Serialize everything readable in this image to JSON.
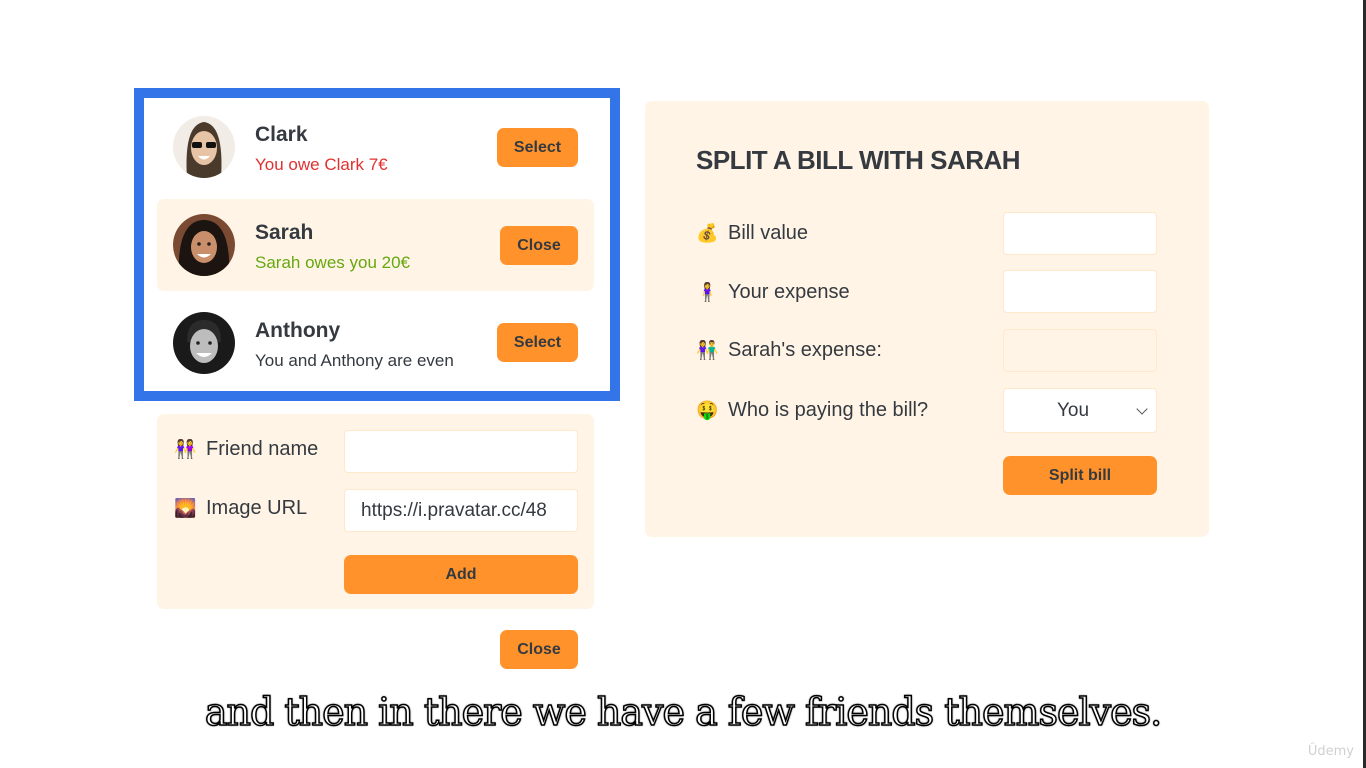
{
  "friends": [
    {
      "name": "Clark",
      "status": "You owe Clark 7€",
      "status_tone": "negative",
      "button": "Select",
      "selected": false
    },
    {
      "name": "Sarah",
      "status": "Sarah owes you 20€",
      "status_tone": "positive",
      "button": "Close",
      "selected": true
    },
    {
      "name": "Anthony",
      "status": "You and Anthony are even",
      "status_tone": "neutral",
      "button": "Select",
      "selected": false
    }
  ],
  "add_friend_form": {
    "friend_name_label": "Friend name",
    "friend_name_icon": "👭",
    "friend_name_value": "",
    "image_url_label": "Image URL",
    "image_url_icon": "🌄",
    "image_url_value": "https://i.pravatar.cc/48",
    "add_button": "Add"
  },
  "close_add_form_button": "Close",
  "split_form": {
    "title": "SPLIT A BILL WITH SARAH",
    "bill_value_icon": "💰",
    "bill_value_label": "Bill value",
    "bill_value": "",
    "your_expense_icon": "🧍‍♀️",
    "your_expense_label": "Your expense",
    "your_expense": "",
    "friend_expense_icon": "👫",
    "friend_expense_label": "Sarah's expense:",
    "friend_expense": "",
    "payer_icon": "🤑",
    "payer_label": "Who is paying the bill?",
    "payer_selected": "You",
    "split_button": "Split bill"
  },
  "subtitle": "and then in there we have a few friends themselves.",
  "watermark": "Ûdemy",
  "colors": {
    "accent": "#ff922b",
    "panel_bg": "#fff4e6",
    "highlight": "#3375e8",
    "negative": "#e03131",
    "positive": "#66a80f"
  }
}
